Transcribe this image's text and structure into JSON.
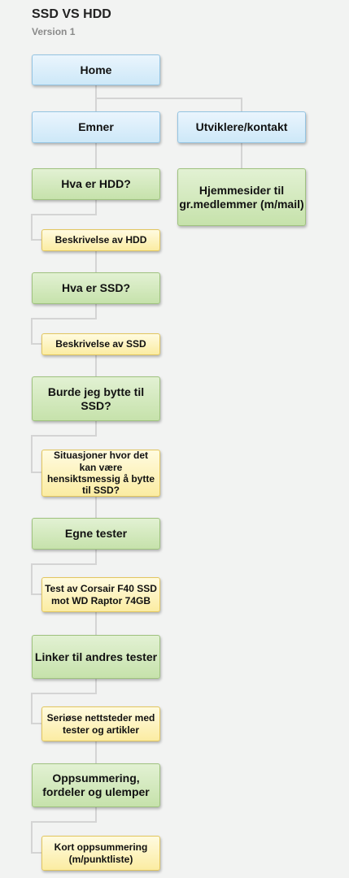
{
  "header": {
    "title": "SSD VS HDD",
    "version": "Version 1"
  },
  "nodes": {
    "home": "Home",
    "emner": "Emner",
    "utviklere": "Utviklere/kontakt",
    "hjemmesider": "Hjemmesider til gr.medlemmer (m/mail)",
    "hva_hdd": "Hva er HDD?",
    "beskrivelse_hdd": "Beskrivelse av HDD",
    "hva_ssd": "Hva er SSD?",
    "beskrivelse_ssd": "Beskrivelse av SSD",
    "burde_bytte": "Burde jeg bytte til SSD?",
    "situasjoner": "Situasjoner hvor det kan være hensiktsmessig å bytte til SSD?",
    "egne_tester": "Egne tester",
    "test_corsair": "Test av Corsair F40 SSD mot WD Raptor 74GB",
    "linker": "Linker til andres tester",
    "seriose": "Seriøse nettsteder med tester og artikler",
    "oppsummering": "Oppsummering, fordeler og ulemper",
    "kort_oppsummering": "Kort oppsummering (m/punktliste)"
  }
}
